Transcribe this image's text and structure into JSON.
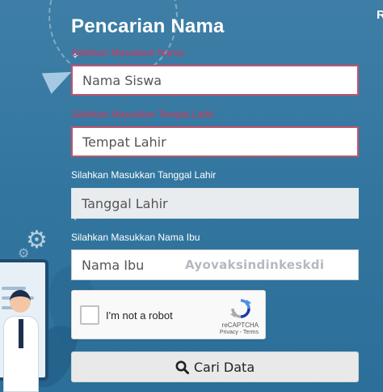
{
  "page": {
    "title": "Pencarian Nama",
    "corner_letter": "R"
  },
  "form": {
    "nama_siswa": {
      "label": "Silahkan Masukkan Nama",
      "placeholder": "Nama Siswa",
      "state": "invalid"
    },
    "tempat_lahir": {
      "label": "Silahkan Masukkan Tempat Lahir",
      "placeholder": "Tempat Lahir",
      "state": "invalid"
    },
    "tanggal_lahir": {
      "label": "Silahkan Masukkan Tanggal Lahir",
      "placeholder": "Tanggal Lahir",
      "state": "disabled"
    },
    "nama_ibu": {
      "label": "Silahkan Masukkan Nama Ibu",
      "placeholder": "Nama Ibu",
      "watermark": "Ayovaksindinkeskdi"
    }
  },
  "recaptcha": {
    "label": "I'm not a robot",
    "brand": "reCAPTCHA",
    "terms": "Privacy - Terms"
  },
  "search_button": {
    "label": "Cari Data",
    "icon": "search-icon"
  },
  "colors": {
    "background": "#3377a0",
    "error_label": "#d9365c",
    "invalid_border": "#c4536a",
    "disabled_field": "#e9ecef"
  }
}
